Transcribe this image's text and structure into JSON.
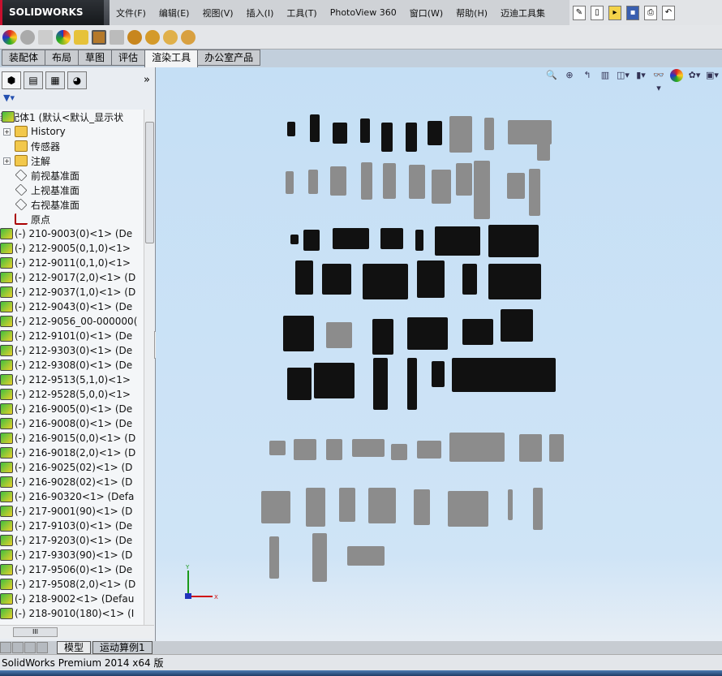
{
  "app": {
    "logo": "SOLIDWORKS",
    "status": "SolidWorks Premium 2014 x64 版"
  },
  "menu": [
    "文件(F)",
    "编辑(E)",
    "视图(V)",
    "插入(I)",
    "工具(T)",
    "PhotoView 360",
    "窗口(W)",
    "帮助(H)",
    "迈迪工具集"
  ],
  "command_tabs": [
    "装配体",
    "布局",
    "草图",
    "评估",
    "渲染工具",
    "办公室产品"
  ],
  "active_tab": "渲染工具",
  "tree": {
    "root": "装配体1  (默认<默认_显示状",
    "items": [
      {
        "label": "History",
        "icon": "history-folder",
        "expand": true
      },
      {
        "label": "传感器",
        "icon": "sensor-folder",
        "expand": false
      },
      {
        "label": "注解",
        "icon": "annotation-folder",
        "expand": true
      },
      {
        "label": "前视基准面",
        "icon": "plane",
        "expand": false
      },
      {
        "label": "上视基准面",
        "icon": "plane",
        "expand": false
      },
      {
        "label": "右视基准面",
        "icon": "plane",
        "expand": false
      },
      {
        "label": "原点",
        "icon": "origin",
        "expand": false
      },
      {
        "label": "(-) 210-9003(0)<1> (De",
        "icon": "part",
        "expand": true
      },
      {
        "label": "(-) 212-9005(0,1,0)<1>",
        "icon": "part",
        "expand": true
      },
      {
        "label": "(-) 212-9011(0,1,0)<1>",
        "icon": "part",
        "expand": true
      },
      {
        "label": "(-) 212-9017(2,0)<1> (D",
        "icon": "part",
        "expand": true
      },
      {
        "label": "(-) 212-9037(1,0)<1> (D",
        "icon": "part",
        "expand": true
      },
      {
        "label": "(-) 212-9043(0)<1> (De",
        "icon": "part",
        "expand": true
      },
      {
        "label": "(-) 212-9056_00-000000(",
        "icon": "part",
        "expand": true
      },
      {
        "label": "(-) 212-9101(0)<1> (De",
        "icon": "part",
        "expand": true
      },
      {
        "label": "(-) 212-9303(0)<1> (De",
        "icon": "part",
        "expand": true
      },
      {
        "label": "(-) 212-9308(0)<1> (De",
        "icon": "part",
        "expand": true
      },
      {
        "label": "(-) 212-9513(5,1,0)<1>",
        "icon": "part",
        "expand": true
      },
      {
        "label": "(-) 212-9528(5,0,0)<1>",
        "icon": "part",
        "expand": true
      },
      {
        "label": "(-) 216-9005(0)<1> (De",
        "icon": "part",
        "expand": true
      },
      {
        "label": "(-) 216-9008(0)<1> (De",
        "icon": "part",
        "expand": true
      },
      {
        "label": "(-) 216-9015(0,0)<1> (D",
        "icon": "part",
        "expand": true
      },
      {
        "label": "(-) 216-9018(2,0)<1> (D",
        "icon": "part",
        "expand": true
      },
      {
        "label": "(-) 216-9025(02)<1> (D",
        "icon": "part",
        "expand": true
      },
      {
        "label": "(-) 216-9028(02)<1> (D",
        "icon": "part",
        "expand": true
      },
      {
        "label": "(-) 216-90320<1> (Defa",
        "icon": "part",
        "expand": true
      },
      {
        "label": "(-) 217-9001(90)<1> (D",
        "icon": "part",
        "expand": true
      },
      {
        "label": "(-) 217-9103(0)<1> (De",
        "icon": "part",
        "expand": true
      },
      {
        "label": "(-) 217-9203(0)<1> (De",
        "icon": "part",
        "expand": true
      },
      {
        "label": "(-) 217-9303(90)<1> (D",
        "icon": "part",
        "expand": true
      },
      {
        "label": "(-) 217-9506(0)<1> (De",
        "icon": "part",
        "expand": true
      },
      {
        "label": "(-) 217-9508(2,0)<1> (D",
        "icon": "part",
        "expand": true
      },
      {
        "label": "(-) 218-9002<1> (Defau",
        "icon": "part",
        "expand": true
      },
      {
        "label": "(-) 218-9010(180)<1> (I",
        "icon": "part",
        "expand": true
      }
    ]
  },
  "bottom_tabs": [
    "模型",
    "运动算例1"
  ],
  "triad": {
    "x": "X",
    "y": "Y"
  },
  "colors": {
    "viewport": "#c5dff5",
    "accent": "#c8102e"
  }
}
